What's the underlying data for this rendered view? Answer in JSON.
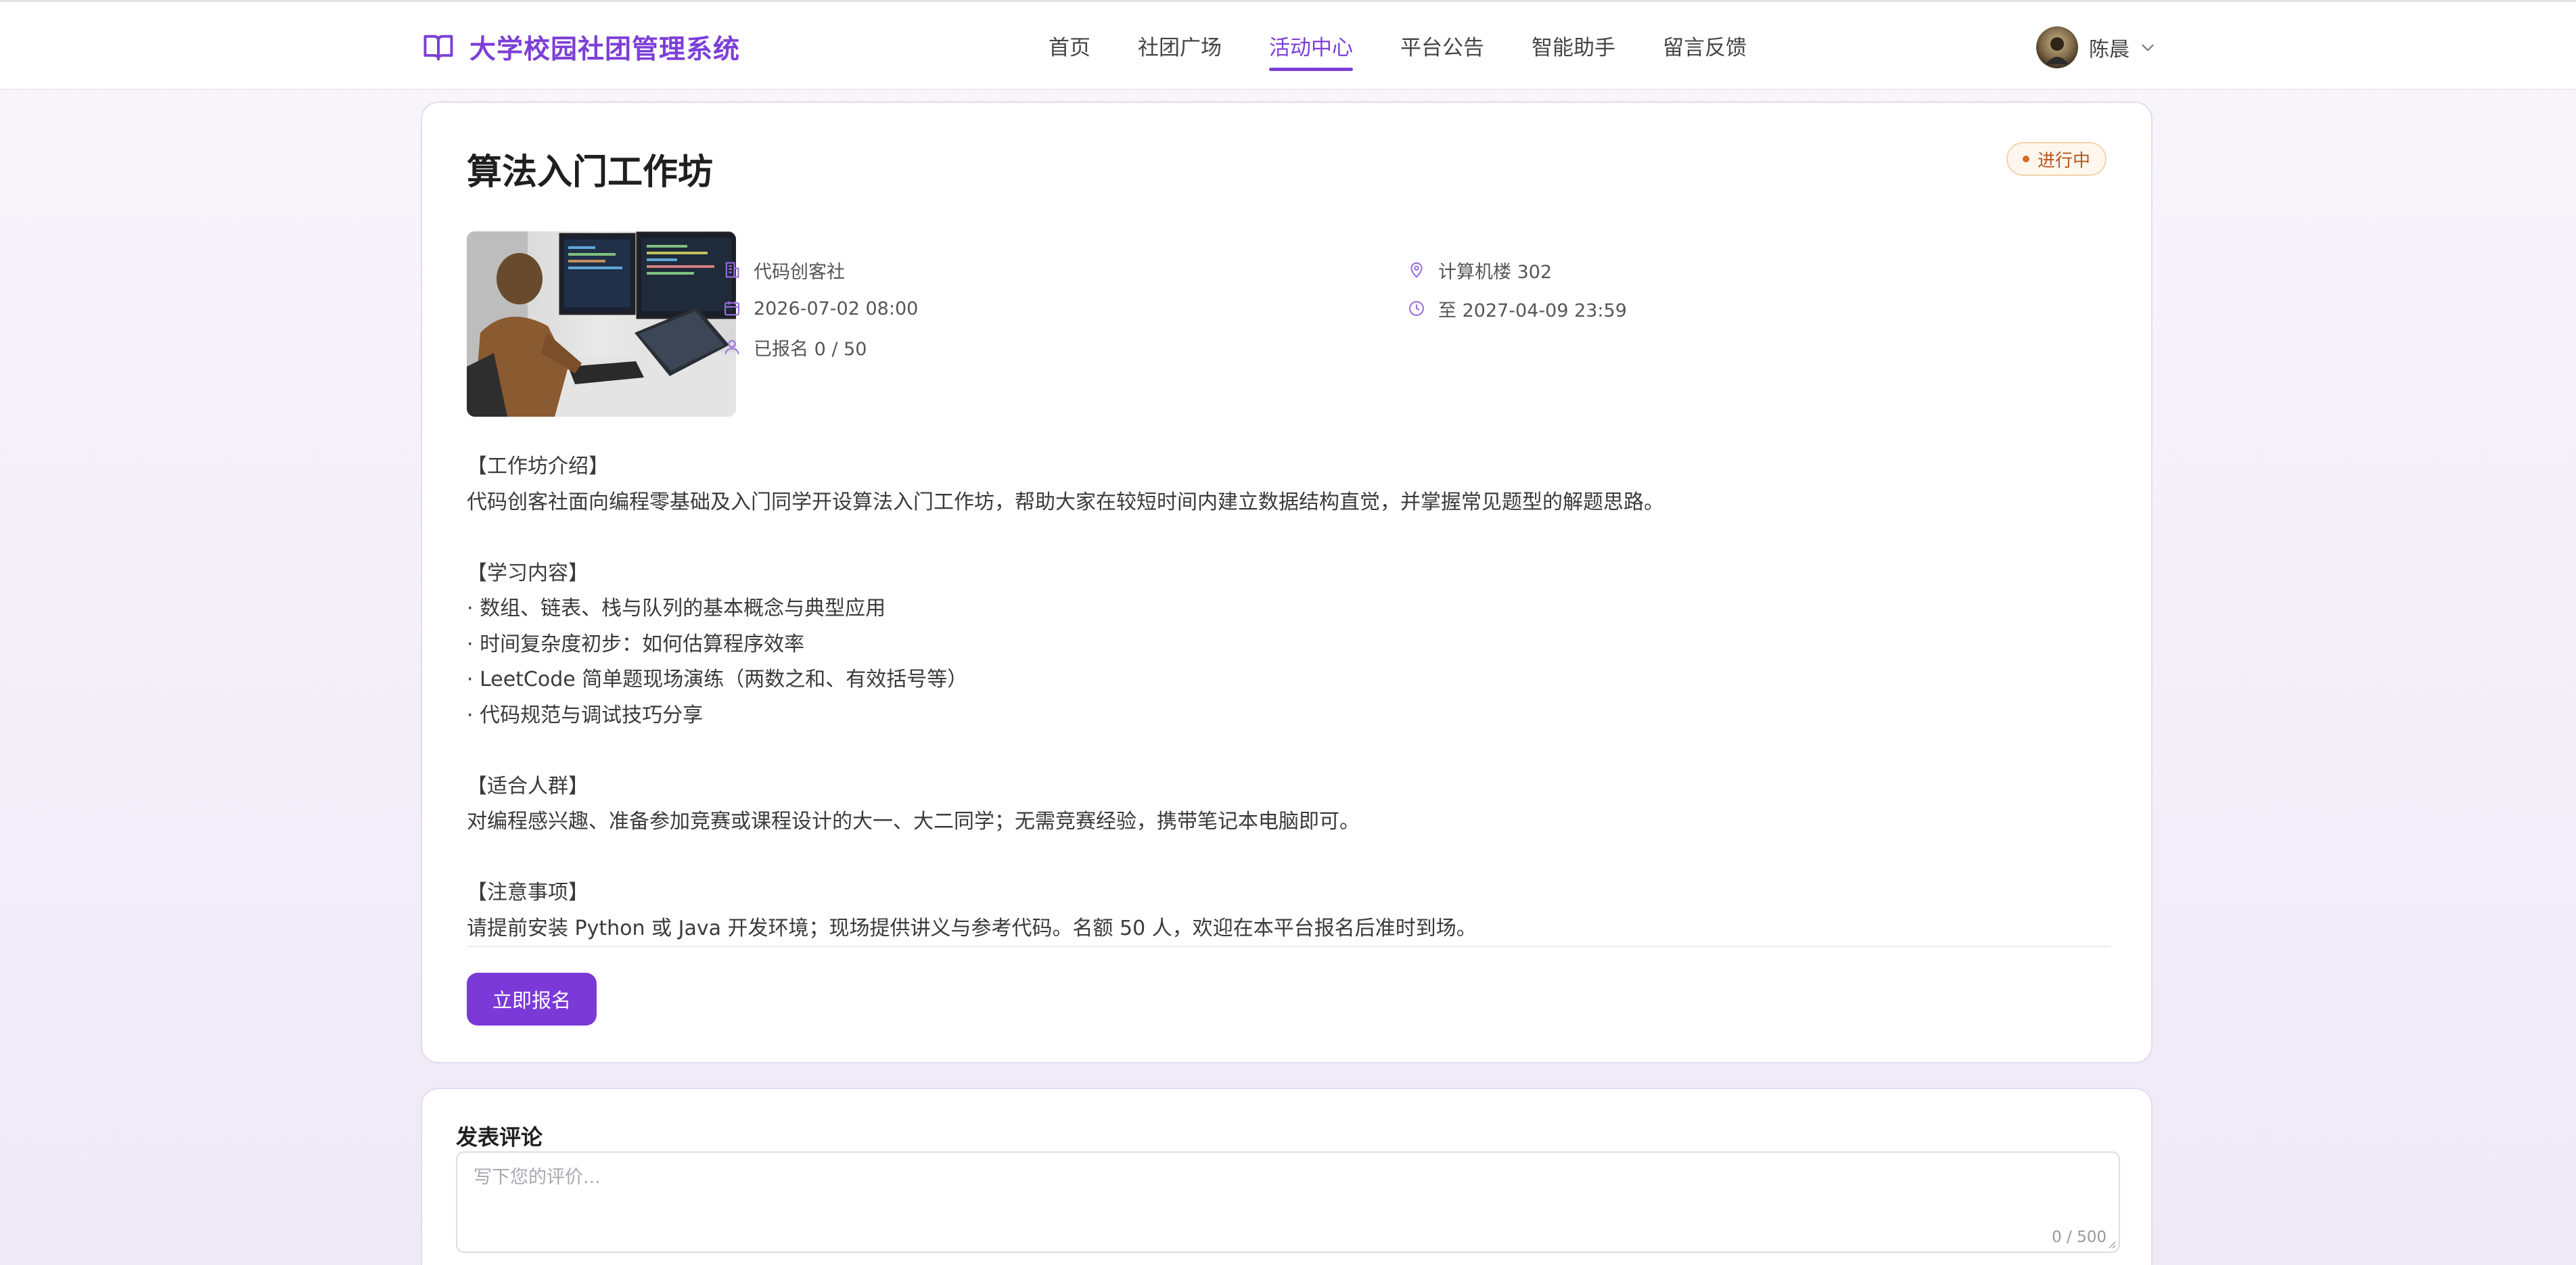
{
  "header": {
    "app_title": "大学校园社团管理系统",
    "nav": [
      {
        "label": "首页"
      },
      {
        "label": "社团广场"
      },
      {
        "label": "活动中心"
      },
      {
        "label": "平台公告"
      },
      {
        "label": "智能助手"
      },
      {
        "label": "留言反馈"
      }
    ],
    "active_nav": "活动中心",
    "user_name": "陈晨",
    "icons": [
      "book-icon",
      "avatar",
      "chevron-down-icon"
    ]
  },
  "activity": {
    "title": "算法入门工作坊",
    "status": "进行中",
    "club": "代码创客社",
    "start_time": "2026-07-02 08:00",
    "registered": "已报名 0 / 50",
    "location": "计算机楼 302",
    "deadline": "至 2027-04-09 23:59",
    "description": "【工作坊介绍】\n代码创客社面向编程零基础及入门同学开设算法入门工作坊，帮助大家在较短时间内建立数据结构直觉，并掌握常见题型的解题思路。\n\n【学习内容】\n· 数组、链表、栈与队列的基本概念与典型应用\n· 时间复杂度初步：如何估算程序效率\n· LeetCode 简单题现场演练（两数之和、有效括号等）\n· 代码规范与调试技巧分享\n\n【适合人群】\n对编程感兴趣、准备参加竞赛或课程设计的大一、大二同学；无需竞赛经验，携带笔记本电脑即可。\n\n【注意事项】\n请提前安装 Python 或 Java 开发环境；现场提供讲义与参考代码。名额 50 人，欢迎在本平台报名后准时到场。",
    "signup_label": "立即报名"
  },
  "comment": {
    "title": "发表评论",
    "placeholder": "写下您的评价...",
    "counter": "0 / 500"
  },
  "colors": {
    "accent": "#7c3fd6",
    "button": "#7b3ad8",
    "status_text": "#b5561f",
    "status_bg": "#fff7ee"
  }
}
